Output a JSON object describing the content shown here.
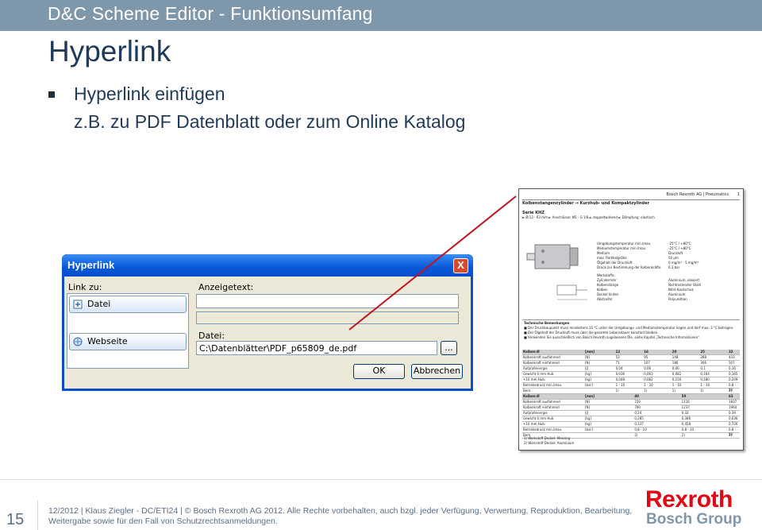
{
  "header": {
    "title": "D&C Scheme Editor - Funktionsumfang"
  },
  "slide": {
    "title": "Hyperlink",
    "bullet": "Hyperlink einfügen",
    "sub": "z.B. zu PDF Datenblatt oder zum Online Katalog"
  },
  "dialog": {
    "title": "Hyperlink",
    "close": "X",
    "link_to_label": "Link zu:",
    "link_items": [
      "Datei",
      "Webseite"
    ],
    "display_text_label": "Anzeigetext:",
    "display_text_value": "",
    "file_label": "Datei:",
    "file_value": "C:\\Datenblätter\\PDF_p65809_de.pdf",
    "browse_button": "...",
    "ok_button": "OK",
    "cancel_button": "Abbrechen"
  },
  "datasheet": {
    "company": "Bosch Rexroth AG | Pneumatics",
    "page": "1",
    "heading": "Kolbenstangenzylinder → Kurzhub- und Kompaktzylinder",
    "series": "Serie KHZ",
    "spec": "► Ø 12 - 63 mm ► Anschlüsse: M5 - G 1/8 ► doppeltwirkend ► Dämpfung: elastisch",
    "props": [
      [
        "Umgebungstemperatur min./max.",
        "-25°C / +80°C"
      ],
      [
        "Mediumstemperatur min./max.",
        "-25°C / +80°C"
      ],
      [
        "Medium",
        "Druckluft"
      ],
      [
        "max. Partikelgröße",
        "50 µm"
      ],
      [
        "Ölgehalt der Druckluft",
        "0 mg/m³ - 5 mg/m³"
      ],
      [
        "Druck zur Bestimmung der Kolbenkräfte",
        "6,3 bar"
      ]
    ],
    "materials_label": "Werkstoffe:",
    "materials": [
      [
        "Zylinderrohr",
        "Aluminium, eloxiert"
      ],
      [
        "Kolbenstange",
        "Nichtrostender Stahl"
      ],
      [
        "Kolben",
        "Nitril-Kautschuk"
      ],
      [
        "Deckel hinten",
        "Aluminium"
      ],
      [
        "Abstreifer",
        "Polyurethan"
      ]
    ],
    "notes_title": "Technische Bemerkungen",
    "notes": [
      "Der Druckbaupunkt muss mindestens 15 °C unter der Umgebungs- und Mediumstemperatur liegen und darf max. 3 °C betragen.",
      "Der Ölgehalt der Druckluft muss über die gesamte Lebensdauer konstant bleiben.",
      "Verwenden Sie ausschließlich von Bosch Rexroth zugelassene Öle, siehe Kapitel „Technische Informationen“."
    ],
    "table1_head": [
      "Kolben-Ø",
      "[mm]",
      "12",
      "16",
      "20",
      "25",
      "32"
    ],
    "table1": [
      [
        "Kolbenkraft ausfahrend",
        "[N]",
        "53",
        "95",
        "148",
        "288",
        "433"
      ],
      [
        "Kolbenkraft einfahrend",
        "[N]",
        "71",
        "107",
        "186",
        "306",
        "507"
      ],
      [
        "Aufprallenergie",
        "[J]",
        "0,04",
        "0,06",
        "0,06",
        "0,1",
        "0,16"
      ],
      [
        "Gewicht 0 mm Hub",
        "[kg]",
        "0,036",
        "0,063",
        "0,082",
        "0,164",
        "0,165"
      ],
      [
        "+10 mm Hub",
        "[kg]",
        "0,048",
        "0,082",
        "0,150",
        "0,180",
        "0,249"
      ],
      [
        "Betriebsdruck min./max.",
        "[bar]",
        "1 - 10",
        "1 - 10",
        "1 - 10",
        "1 - 10",
        "0,8 - 10"
      ],
      [
        "Bem.",
        "",
        "1)",
        "1)",
        "1)",
        "1)",
        "2)"
      ]
    ],
    "table2_head": [
      "Kolben-Ø",
      "[mm]",
      "40",
      "50",
      "63"
    ],
    "table2": [
      [
        "Kolbenkraft ausfahrend",
        "[N]",
        "720",
        "1116",
        "1837"
      ],
      [
        "Kolbenkraft einfahrend",
        "[N]",
        "790",
        "1237",
        "1964"
      ],
      [
        "Aufprallenergie",
        "[J]",
        "0,24",
        "0,32",
        "0,39"
      ],
      [
        "Gewicht 0 mm Hub",
        "[kg]",
        "0,285",
        "0,386",
        "0,636"
      ],
      [
        "+10 mm Hub",
        "[kg]",
        "0,337",
        "0,458",
        "0,726"
      ],
      [
        "Betriebsdruck min./max.",
        "[bar]",
        "0,8 - 10",
        "0,8 - 10",
        "0,8 - 10"
      ],
      [
        "Bem.",
        "",
        "2)",
        "2)",
        "2)"
      ]
    ],
    "footnotes": [
      "1) Werkstoff Deckel: Messing",
      "2) Werkstoff Deckel: Aluminium"
    ]
  },
  "footer": {
    "page_number": "15",
    "text": "12/2012 | Klaus Ziegler - DC/ETI24 | © Bosch Rexroth AG 2012. Alle Rechte vorbehalten, auch bzgl. jeder Verfügung, Verwertung, Reproduktion, Bearbeitung, Weitergabe sowie für den Fall von Schutzrechtsanmeldungen.",
    "brand_main": "Rexroth",
    "brand_sub": "Bosch Group"
  },
  "colors": {
    "header_bar": "#7f97aa",
    "title_text": "#1f3a5a",
    "dialog_blue": "#0a4fc9",
    "brand_red": "#e30613",
    "connector_line": "#c0141c"
  }
}
